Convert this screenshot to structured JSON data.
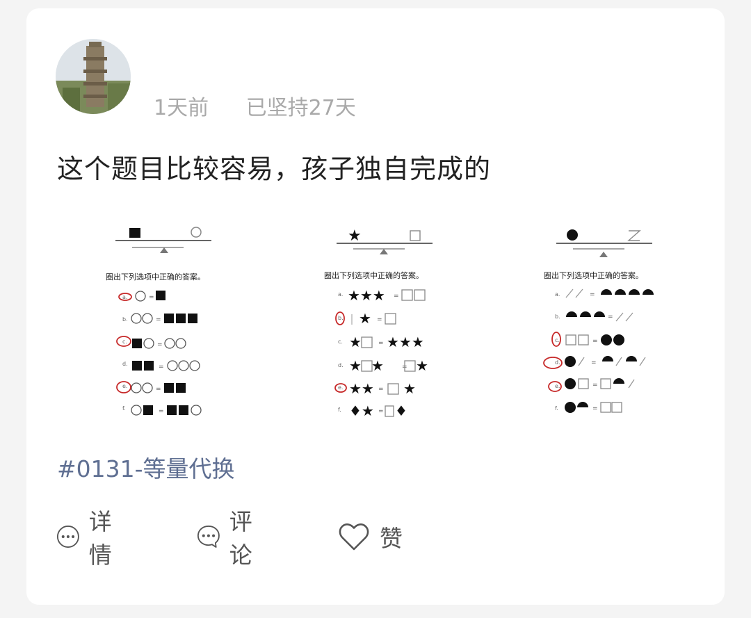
{
  "post": {
    "username": "",
    "time_ago": "1天前",
    "streak": "已坚持27天",
    "text": "这个题目比较容易，孩子独自完成的",
    "hashtag": "#0131-等量代换"
  },
  "puzzles": [
    {
      "instruction": "圈出下列选项中正确的答案。",
      "labels": [
        "a.",
        "b.",
        "c.",
        "d.",
        "e.",
        "f."
      ]
    },
    {
      "instruction": "圈出下列选项中正确的答案。",
      "labels": [
        "a.",
        "b.",
        "c.",
        "d.",
        "e.",
        "f."
      ]
    },
    {
      "instruction": "圈出下列选项中正确的答案。",
      "labels": [
        "a.",
        "b.",
        "c.",
        "d.",
        "e.",
        "f."
      ]
    }
  ],
  "actions": {
    "details": "详情",
    "comment": "评论",
    "like": "赞"
  },
  "icons": {
    "details": "more-circle-icon",
    "comment": "comment-bubble-icon",
    "like": "heart-icon"
  },
  "colors": {
    "meta": "#a9a9a9",
    "hashtag": "#5f6f92",
    "circle_mark": "#c62828"
  }
}
